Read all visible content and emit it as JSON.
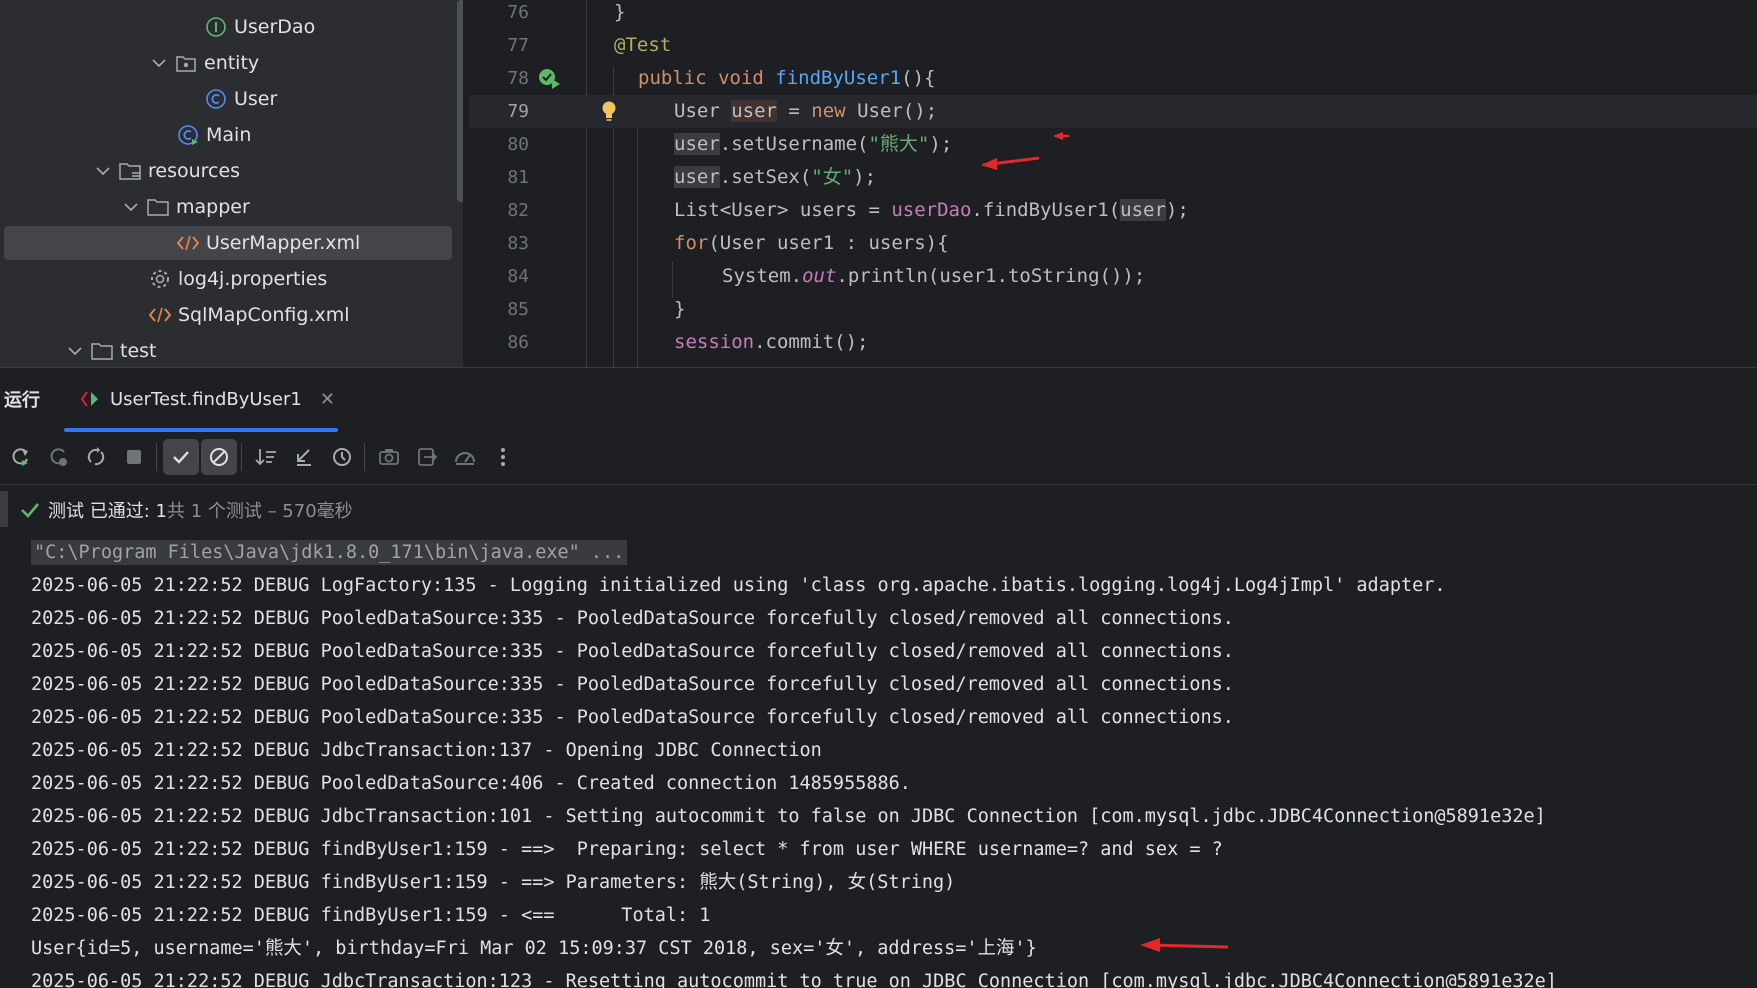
{
  "project_tree": {
    "items": [
      {
        "label": "UserDao",
        "icon": "interface-icon",
        "chevron": false
      },
      {
        "label": "entity",
        "icon": "package-icon",
        "chevron": "down"
      },
      {
        "label": "User",
        "icon": "class-icon",
        "chevron": false
      },
      {
        "label": "Main",
        "icon": "main-class-icon",
        "chevron": false
      },
      {
        "label": "resources",
        "icon": "resources-folder-icon",
        "chevron": "down"
      },
      {
        "label": "mapper",
        "icon": "folder-icon",
        "chevron": "down"
      },
      {
        "label": "UserMapper.xml",
        "icon": "xml-icon",
        "chevron": false,
        "selected": true
      },
      {
        "label": "log4j.properties",
        "icon": "gear-icon",
        "chevron": false
      },
      {
        "label": "SqlMapConfig.xml",
        "icon": "xml-icon",
        "chevron": false
      },
      {
        "label": "test",
        "icon": "folder-icon",
        "chevron": "down"
      }
    ]
  },
  "editor": {
    "current_line": "79",
    "lines": [
      {
        "num": "76",
        "code": "}"
      },
      {
        "num": "77",
        "code": "@Test"
      },
      {
        "num": "78",
        "code": "public void findByUser1(){"
      },
      {
        "num": "79",
        "code": "User user = new User();"
      },
      {
        "num": "80",
        "code": "user.setUsername(\"熊大\");"
      },
      {
        "num": "81",
        "code": "user.setSex(\"女\");"
      },
      {
        "num": "82",
        "code": "List<User> users = userDao.findByUser1(user);"
      },
      {
        "num": "83",
        "code": "for(User user1 : users){"
      },
      {
        "num": "84",
        "code": "System.out.println(user1.toString());"
      },
      {
        "num": "85",
        "code": "}"
      },
      {
        "num": "86",
        "code": "session.commit();"
      }
    ]
  },
  "run_panel": {
    "title": "运行",
    "tab_label": "UserTest.findByUser1",
    "toolbar_icons": [
      "rerun-icon",
      "rerun-failed-icon",
      "toggle-auto-test-icon",
      "stop-icon",
      "show-passed-icon",
      "show-ignored-icon",
      "sort-icon",
      "import-tests-icon",
      "history-icon",
      "screenshot-icon",
      "export-icon",
      "coverage-icon",
      "more-icon"
    ],
    "status_pass": "测试 已通过: 1",
    "status_detail": "共 1 个测试 – 570毫秒"
  },
  "console": {
    "lines": [
      "\"C:\\Program Files\\Java\\jdk1.8.0_171\\bin\\java.exe\" ...",
      "2025-06-05 21:22:52 DEBUG LogFactory:135 - Logging initialized using 'class org.apache.ibatis.logging.log4j.Log4jImpl' adapter.",
      "2025-06-05 21:22:52 DEBUG PooledDataSource:335 - PooledDataSource forcefully closed/removed all connections.",
      "2025-06-05 21:22:52 DEBUG PooledDataSource:335 - PooledDataSource forcefully closed/removed all connections.",
      "2025-06-05 21:22:52 DEBUG PooledDataSource:335 - PooledDataSource forcefully closed/removed all connections.",
      "2025-06-05 21:22:52 DEBUG PooledDataSource:335 - PooledDataSource forcefully closed/removed all connections.",
      "2025-06-05 21:22:52 DEBUG JdbcTransaction:137 - Opening JDBC Connection",
      "2025-06-05 21:22:52 DEBUG PooledDataSource:406 - Created connection 1485955886.",
      "2025-06-05 21:22:52 DEBUG JdbcTransaction:101 - Setting autocommit to false on JDBC Connection [com.mysql.jdbc.JDBC4Connection@5891e32e]",
      "2025-06-05 21:22:52 DEBUG findByUser1:159 - ==>  Preparing: select * from user WHERE username=? and sex = ?",
      "2025-06-05 21:22:52 DEBUG findByUser1:159 - ==> Parameters: 熊大(String), 女(String)",
      "2025-06-05 21:22:52 DEBUG findByUser1:159 - <==      Total: 1",
      "User{id=5, username='熊大', birthday=Fri Mar 02 15:09:37 CST 2018, sex='女', address='上海'}",
      "2025-06-05 21:22:52 DEBUG JdbcTransaction:123 - Resetting autocommit to true on JDBC Connection [com.mysql.jdbc.JDBC4Connection@5891e32e]"
    ]
  },
  "colors": {
    "accent": "#3574f0",
    "annotation_arrow": "#e5262a",
    "pass_green": "#5fb865"
  }
}
